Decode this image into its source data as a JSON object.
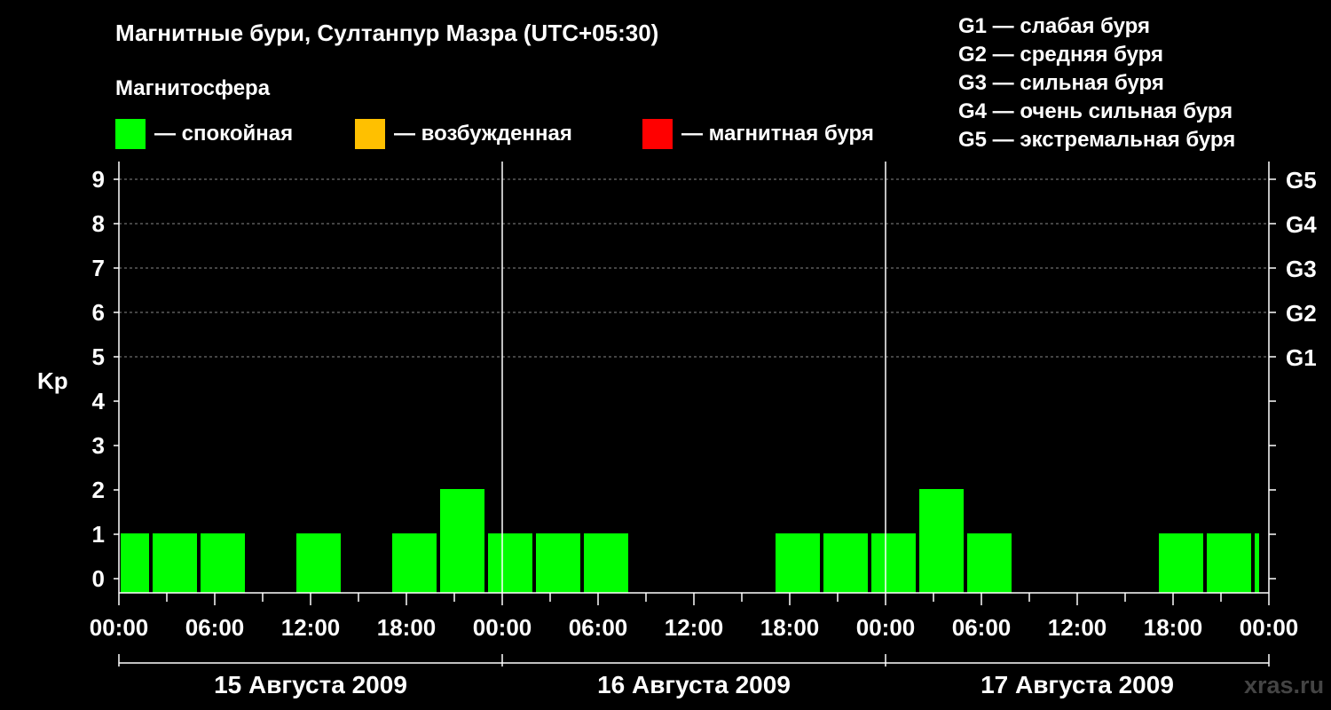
{
  "header": {
    "title": "Магнитные бури, Султанпур Мазра (UTC+05:30)",
    "magnetosphere_label": "Магнитосфера"
  },
  "legend": [
    {
      "color": "#00ff00",
      "label": "— спокойная"
    },
    {
      "color": "#ffc000",
      "label": "— возбужденная"
    },
    {
      "color": "#ff0000",
      "label": "— магнитная буря"
    }
  ],
  "g_scale": [
    "G1 — слабая буря",
    "G2 — средняя буря",
    "G3 — сильная буря",
    "G4 — очень сильная буря",
    "G5 — экстремальная буря"
  ],
  "watermark": "xras.ru",
  "chart_data": {
    "type": "bar",
    "ylabel": "Kp",
    "ylim": [
      0,
      9
    ],
    "y_ticks": [
      0,
      1,
      2,
      3,
      4,
      5,
      6,
      7,
      8,
      9
    ],
    "right_ticks": [
      {
        "value": 5,
        "label": "G1"
      },
      {
        "value": 6,
        "label": "G2"
      },
      {
        "value": 7,
        "label": "G3"
      },
      {
        "value": 8,
        "label": "G4"
      },
      {
        "value": 9,
        "label": "G5"
      }
    ],
    "x_tick_labels": [
      "00:00",
      "06:00",
      "12:00",
      "18:00",
      "00:00",
      "06:00",
      "12:00",
      "18:00",
      "00:00",
      "06:00",
      "12:00",
      "18:00",
      "00:00"
    ],
    "x_tick_hours": [
      0,
      6,
      12,
      18,
      24,
      30,
      36,
      42,
      48,
      54,
      60,
      66,
      72
    ],
    "grid_values": [
      5,
      6,
      7,
      8,
      9
    ],
    "days": [
      {
        "label": "15 Августа 2009",
        "start_hour": 0,
        "end_hour": 24
      },
      {
        "label": "16 Августа 2009",
        "start_hour": 24,
        "end_hour": 48
      },
      {
        "label": "17 Августа 2009",
        "start_hour": 48,
        "end_hour": 72
      }
    ],
    "x_range_hours": [
      0,
      72
    ],
    "bar_colors": {
      "quiet": "#00ff00",
      "active": "#ffc000",
      "storm": "#ff0000"
    },
    "series": [
      {
        "start_hour": [
          0,
          2,
          5,
          11,
          17,
          20,
          23,
          26,
          29,
          41,
          44,
          47,
          50,
          53,
          65,
          68,
          71
        ],
        "end_hour": [
          2,
          5,
          8,
          14,
          20,
          23,
          26,
          29,
          32,
          44,
          47,
          50,
          53,
          56,
          68,
          71,
          71.5
        ],
        "kp": [
          1,
          1,
          1,
          1,
          1,
          2,
          1,
          1,
          1,
          1,
          1,
          1,
          2,
          1,
          1,
          1,
          1
        ]
      }
    ]
  }
}
